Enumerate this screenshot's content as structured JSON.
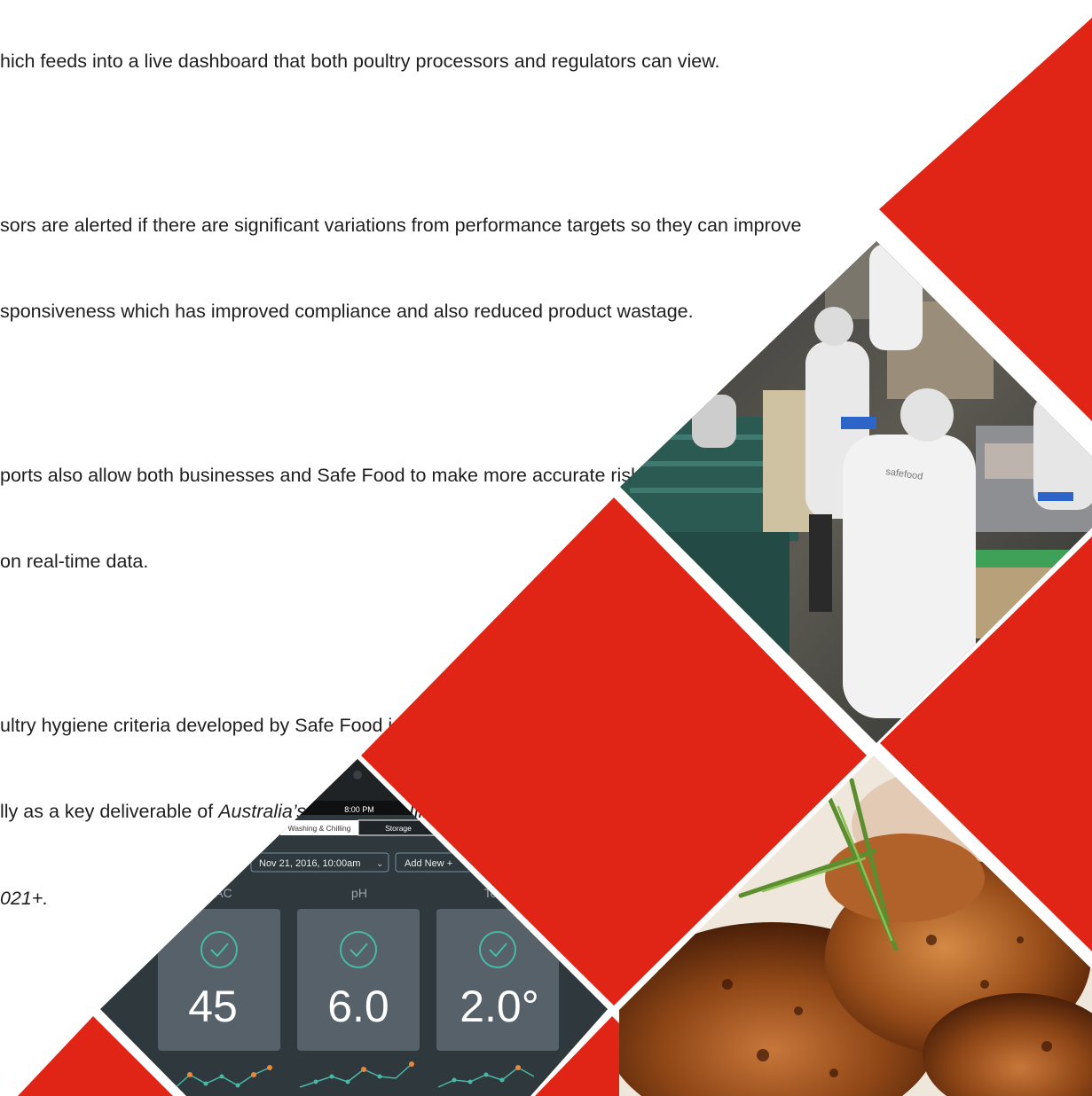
{
  "paragraphs": [
    {
      "lines": [
        "hich feeds into a live dashboard that both poultry processors and regulators can view."
      ]
    },
    {
      "lines": [
        "sors are alerted if there are significant variations from performance targets so they can improve",
        "sponsiveness which has improved compliance and also reduced product wastage."
      ]
    },
    {
      "lines": [
        "ports also allow both businesses and Safe Food to make more accurate risk assessments",
        "on real-time data."
      ]
    },
    {
      "lines": [
        "ultry hygiene criteria developed by Safe Food is now being implemented"
      ],
      "line2_plain": "lly as a key deliverable of ",
      "line2_italic": "Australia’s Foodborne Illness Reduction Strategy",
      "line3_italic": "021+."
    }
  ],
  "dashboard": {
    "time": "8:00 PM",
    "tabs": [
      "Washing & Chilling",
      "Storage"
    ],
    "date_selector": "Nov 21, 2016, 10:00am",
    "add_new": "Add New +",
    "metrics": [
      {
        "label": "AC",
        "value": "45"
      },
      {
        "label": "pH",
        "value": "6.0"
      },
      {
        "label": "Te",
        "value": "2.0°"
      }
    ]
  },
  "photo_label": "safefood",
  "colors": {
    "red": "#e02416",
    "dash_bg": "#2f383d",
    "card": "#56616a",
    "teal": "#48b9a6",
    "orange": "#e6893c"
  }
}
